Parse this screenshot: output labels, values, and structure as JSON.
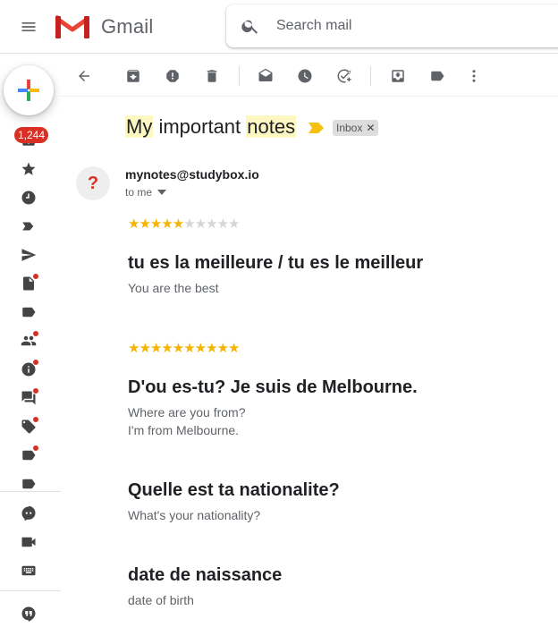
{
  "app": {
    "brand": "Gmail"
  },
  "search": {
    "placeholder": "Search mail"
  },
  "rail": {
    "unread_count": "1,244"
  },
  "email": {
    "subject_parts": [
      "My",
      " important ",
      "notes"
    ],
    "label_chip": "Inbox",
    "sender": "mynotes@studybox.io",
    "recipient": "to me",
    "avatar_glyph": "?"
  },
  "sections": [
    {
      "stars_on": "★★★★★",
      "stars_off": "★★★★★",
      "heading": "tu es la meilleure / tu es le meilleur",
      "lines": [
        "You are the best"
      ]
    },
    {
      "stars_on": "★★★★★★★★★★",
      "stars_off": "",
      "heading": "D'ou es-tu? Je suis de Melbourne.",
      "lines": [
        "Where are you from?",
        "I'm from Melbourne."
      ]
    },
    {
      "stars_on": "",
      "stars_off": "",
      "heading": "Quelle est ta nationalite?",
      "lines": [
        "What's your nationality?"
      ]
    },
    {
      "stars_on": "",
      "stars_off": "",
      "heading": "date de naissance",
      "lines": [
        "date of birth"
      ]
    }
  ],
  "colors": {
    "accent_red": "#d93025",
    "star": "#f4b400",
    "highlight": "#fdf8c1"
  }
}
